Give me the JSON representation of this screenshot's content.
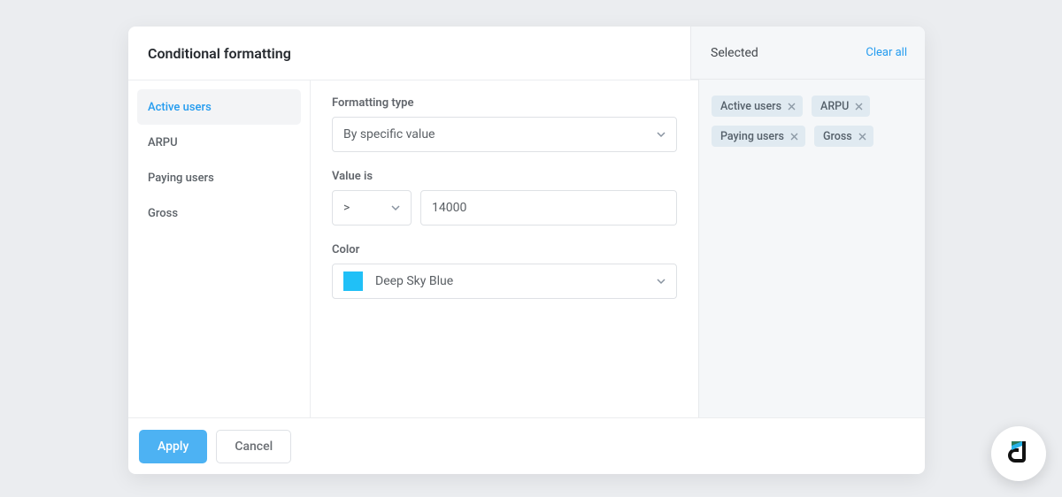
{
  "title": "Conditional formatting",
  "sidebar": {
    "items": [
      {
        "label": "Active users",
        "active": true
      },
      {
        "label": "ARPU",
        "active": false
      },
      {
        "label": "Paying users",
        "active": false
      },
      {
        "label": "Gross",
        "active": false
      }
    ]
  },
  "form": {
    "formatting_type_label": "Formatting type",
    "formatting_type_value": "By specific value",
    "value_is_label": "Value is",
    "operator": ">",
    "value": "14000",
    "color_label": "Color",
    "color_name": "Deep Sky Blue",
    "color_hex": "#20c0f7"
  },
  "selected": {
    "header": "Selected",
    "clear_all": "Clear all",
    "chips": [
      {
        "label": "Active users"
      },
      {
        "label": "ARPU"
      },
      {
        "label": "Paying users"
      },
      {
        "label": "Gross"
      }
    ]
  },
  "footer": {
    "apply": "Apply",
    "cancel": "Cancel"
  }
}
